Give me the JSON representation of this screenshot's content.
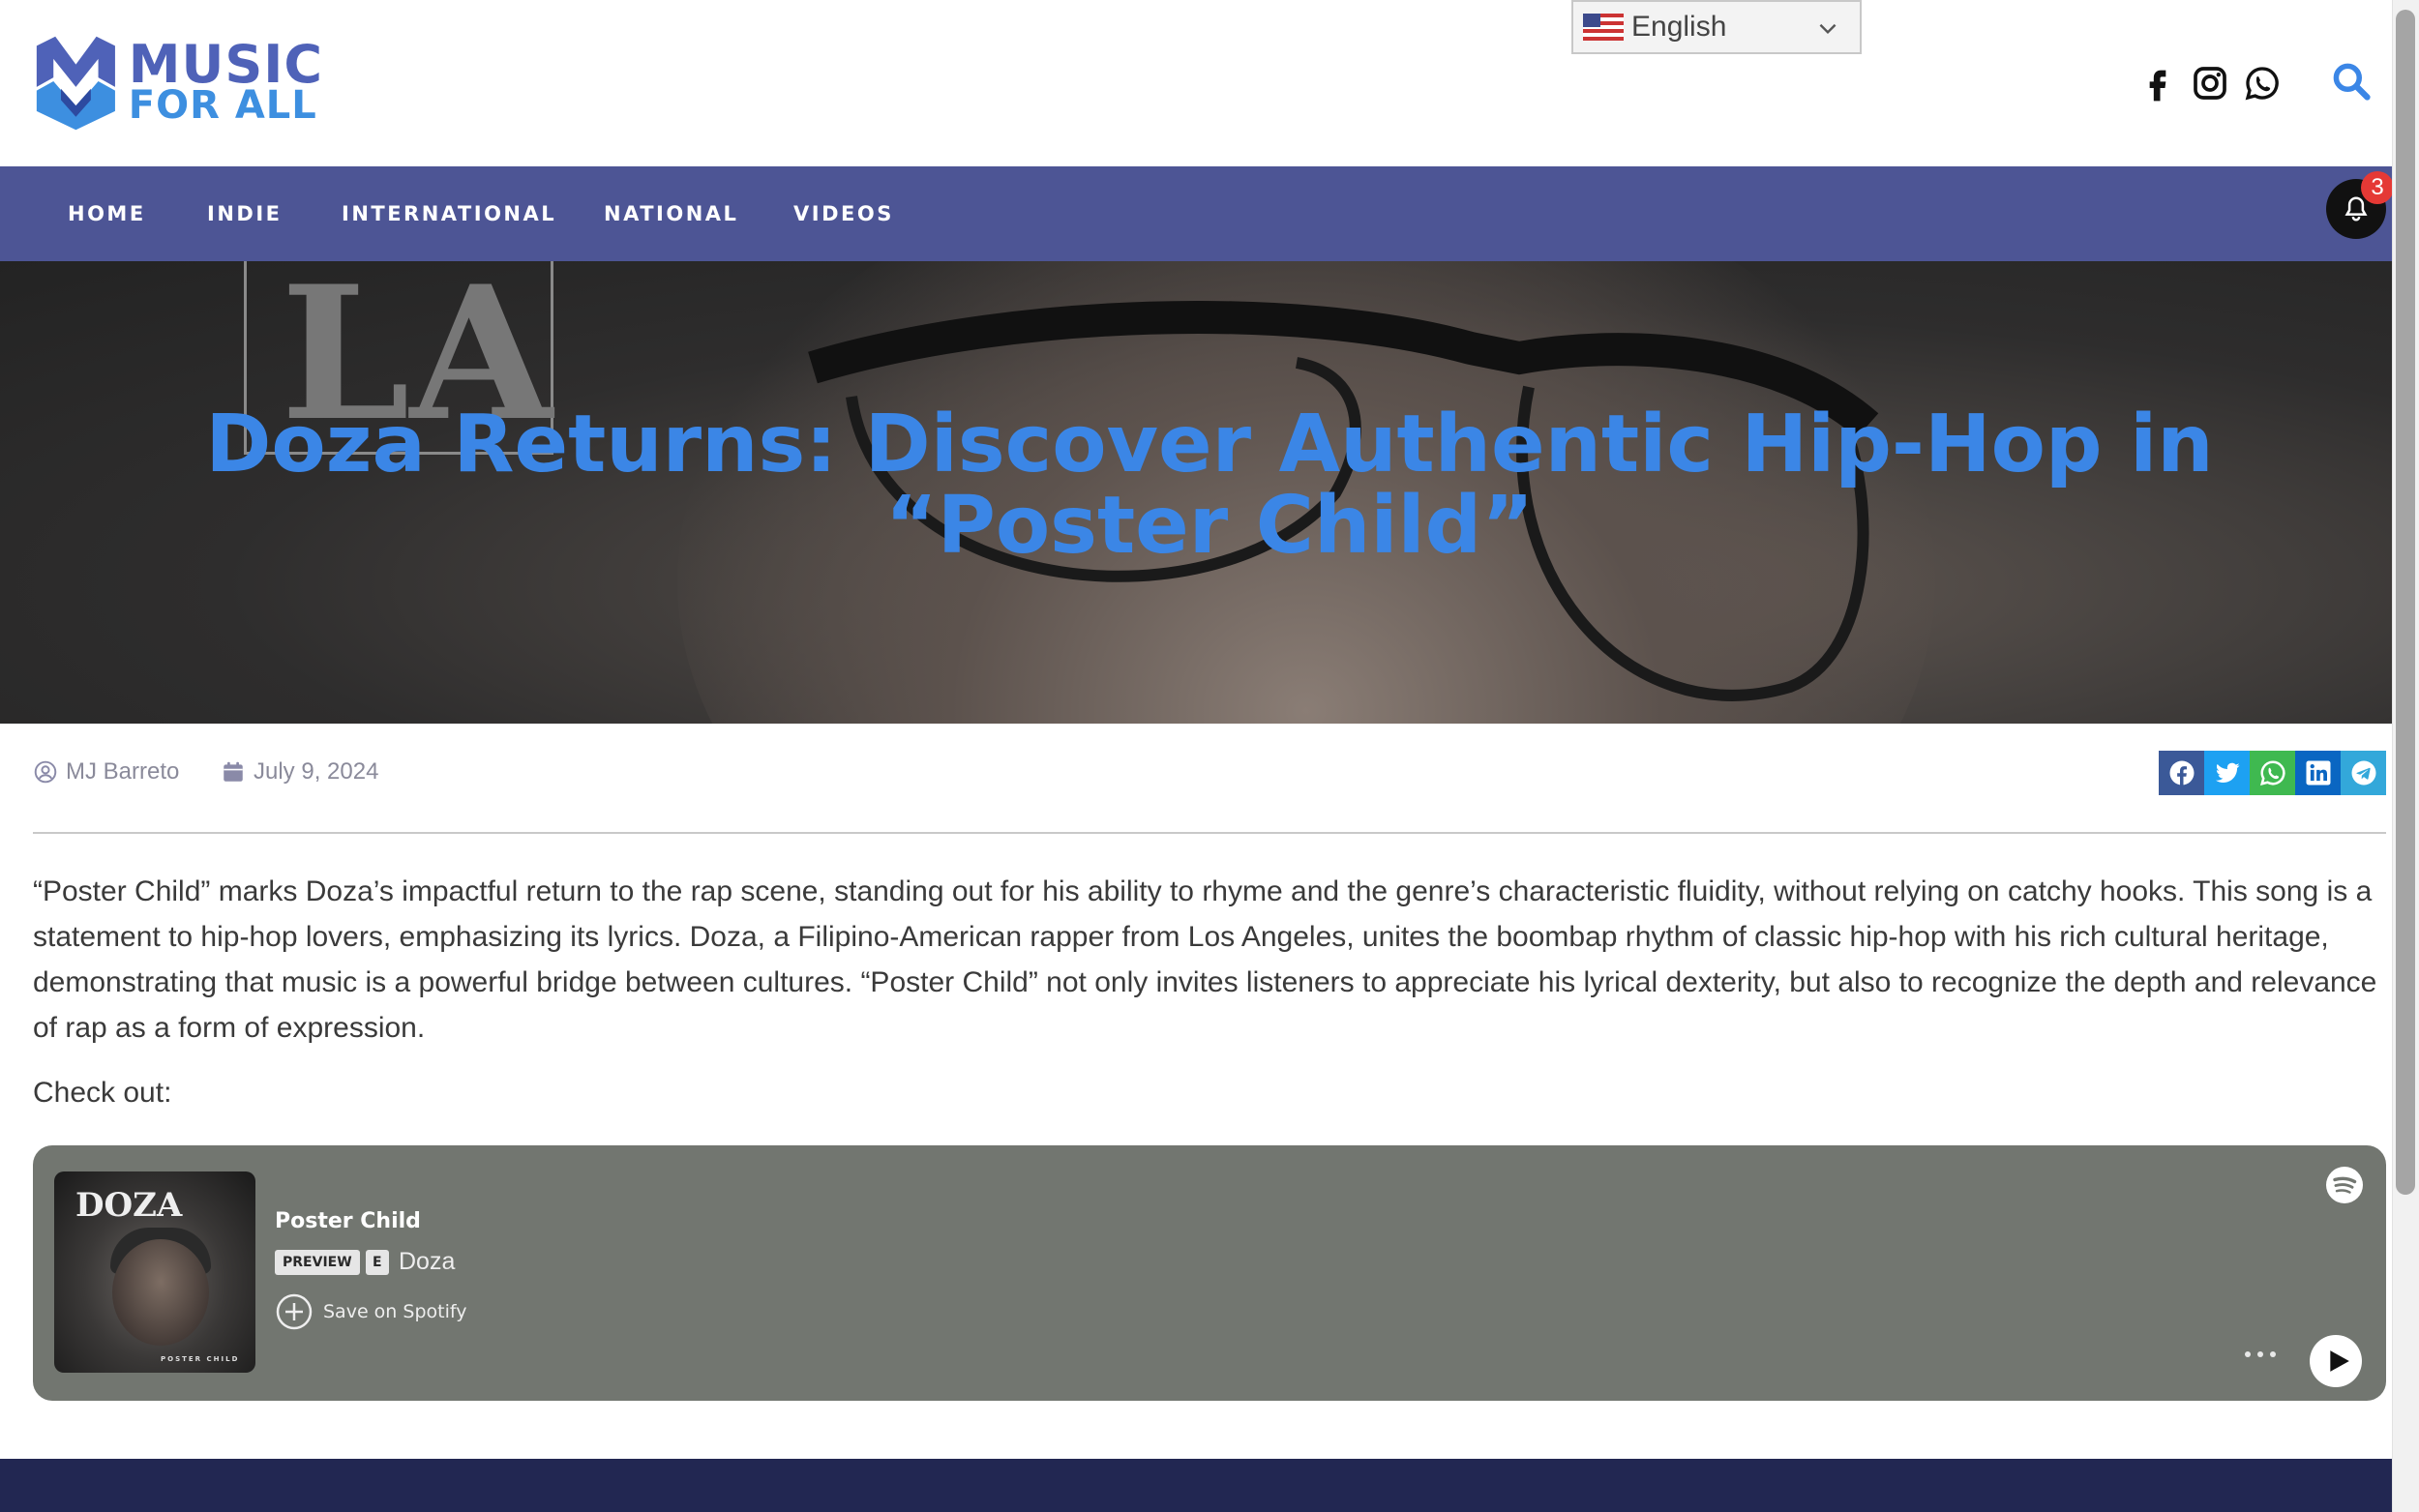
{
  "site": {
    "logo_line1": "MUSIC",
    "logo_line2": "FOR ALL",
    "language": "English",
    "social_icons": [
      "facebook-icon",
      "instagram-icon",
      "whatsapp-icon"
    ],
    "colors": {
      "nav_bg": "#4d5595",
      "title": "#3b86e6",
      "footer_bg": "#222752"
    }
  },
  "nav": {
    "items": [
      {
        "label": "HOME"
      },
      {
        "label": "INDIE"
      },
      {
        "label": "INTERNATIONAL"
      },
      {
        "label": "NATIONAL"
      },
      {
        "label": "VIDEOS"
      }
    ],
    "notification_count": "3"
  },
  "hero": {
    "title": "Doza Returns: Discover Authentic Hip-Hop in “Poster Child”"
  },
  "meta": {
    "author": "MJ Barreto",
    "date": "July 9, 2024",
    "share_icons": [
      "facebook-icon",
      "twitter-icon",
      "whatsapp-icon",
      "linkedin-icon",
      "telegram-icon"
    ]
  },
  "article": {
    "paragraph": "“Poster Child” marks Doza’s impactful return to the rap scene, standing out for his ability to rhyme and the genre’s characteristic fluidity, without relying on catchy hooks. This song is a statement to hip-hop lovers, emphasizing its lyrics. Doza, a Filipino-American rapper from Los Angeles, unites the boombap rhythm of classic hip-hop with his rich cultural heritage, demonstrating that music is a powerful bridge between cultures. “Poster Child” not only invites listeners to appreciate his lyrical dexterity, but also to recognize the depth and relevance of rap as a form of expression.",
    "check_out": "Check out:"
  },
  "spotify": {
    "track": "Poster Child",
    "preview_badge": "PREVIEW",
    "explicit_badge": "E",
    "artist": "Doza",
    "save_label": "Save on Spotify",
    "cover_text": "DOZA",
    "cover_caption": "POSTER CHILD"
  }
}
